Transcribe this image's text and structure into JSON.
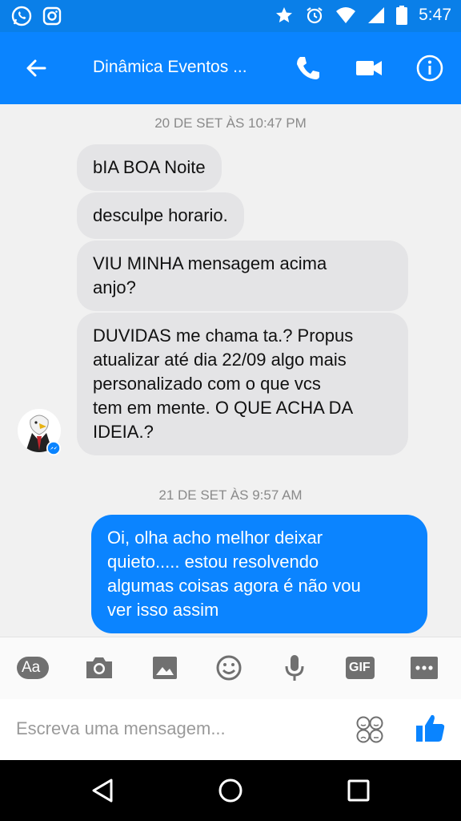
{
  "status_bar": {
    "time": "5:47"
  },
  "header": {
    "title": "Dinâmica Eventos ..."
  },
  "messages": {
    "timestamp_1": "20 DE SET ÀS 10:47 PM",
    "incoming": [
      {
        "lines": [
          "bIA BOA Noite"
        ]
      },
      {
        "lines": [
          "desculpe horario."
        ]
      },
      {
        "lines": [
          "VIU MINHA mensagem acima",
          "anjo?"
        ]
      },
      {
        "lines": [
          "DUVIDAS me chama ta.? Propus",
          "atualizar até dia 22/09 algo mais",
          "personalizado com o que vcs",
          "tem em mente. O QUE ACHA DA",
          "IDEIA.?"
        ]
      }
    ],
    "timestamp_2": "21 DE SET ÀS 9:57 AM",
    "outgoing": [
      {
        "lines": [
          "Oi, olha acho melhor deixar",
          "quieto..... estou resolvendo",
          "algumas coisas agora é não vou",
          "ver isso assim"
        ]
      }
    ]
  },
  "toolbar": {
    "icons": [
      "text-size-icon",
      "camera-icon",
      "image-icon",
      "emoji-icon",
      "microphone-icon",
      "gif-icon",
      "more-icon"
    ],
    "aa_label": "Aa",
    "gif_label": "GIF"
  },
  "composer": {
    "placeholder": "Escreva uma mensagem..."
  },
  "colors": {
    "accent": "#0a84ff",
    "status": "#0a7fe8",
    "incoming_bubble": "#e4e4e6",
    "outgoing_bubble": "#0b84ff"
  }
}
